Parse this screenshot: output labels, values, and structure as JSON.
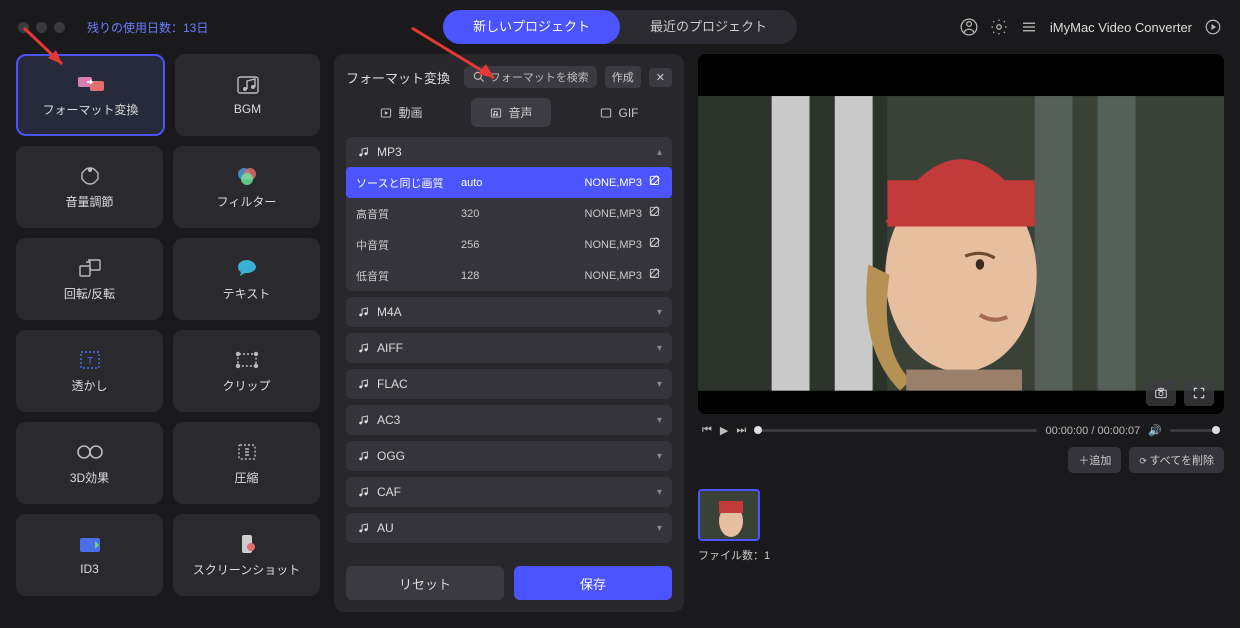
{
  "topbar": {
    "trial_text": "残りの使用日数：13日",
    "tabs": {
      "new_project": "新しいプロジェクト",
      "recent": "最近のプロジェクト"
    },
    "brand": "iMyMac Video Converter"
  },
  "sidebar": {
    "tiles": [
      {
        "label": "フォーマット変換",
        "icon": "convert",
        "active": true
      },
      {
        "label": "BGM",
        "icon": "bgm"
      },
      {
        "label": "音量調節",
        "icon": "volume"
      },
      {
        "label": "フィルター",
        "icon": "filter"
      },
      {
        "label": "回転/反転",
        "icon": "rotate"
      },
      {
        "label": "テキスト",
        "icon": "text"
      },
      {
        "label": "透かし",
        "icon": "watermark"
      },
      {
        "label": "クリップ",
        "icon": "clip"
      },
      {
        "label": "3D効果",
        "icon": "3d"
      },
      {
        "label": "圧縮",
        "icon": "compress"
      },
      {
        "label": "ID3",
        "icon": "id3"
      },
      {
        "label": "スクリーンショット",
        "icon": "screenshot"
      }
    ]
  },
  "center": {
    "title": "フォーマット変換",
    "search_placeholder": "フォーマットを検索",
    "create": "作成",
    "fmt_tabs": {
      "video": "動画",
      "audio": "音声",
      "gif": "GIF"
    },
    "mp3_name": "MP3",
    "mp3_options": [
      {
        "quality": "ソースと同じ画質",
        "bitrate": "auto",
        "codec": "NONE,MP3",
        "selected": true
      },
      {
        "quality": "高音質",
        "bitrate": "320",
        "codec": "NONE,MP3"
      },
      {
        "quality": "中音質",
        "bitrate": "256",
        "codec": "NONE,MP3"
      },
      {
        "quality": "低音質",
        "bitrate": "128",
        "codec": "NONE,MP3"
      }
    ],
    "groups": [
      "M4A",
      "AIFF",
      "FLAC",
      "AC3",
      "OGG",
      "CAF",
      "AU"
    ],
    "reset": "リセット",
    "save": "保存"
  },
  "player": {
    "time_current": "00:00:00",
    "time_total": "00:00:07"
  },
  "right": {
    "add": "＋追加",
    "delete_all": "すべてを削除",
    "file_count_label": "ファイル数：1"
  }
}
